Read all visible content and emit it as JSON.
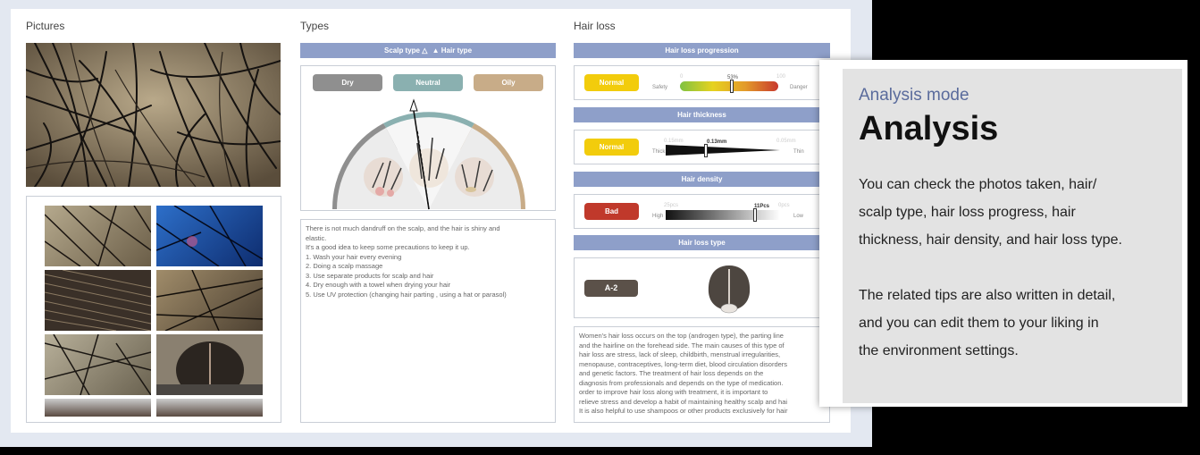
{
  "sections": {
    "pictures": "Pictures",
    "types": "Types",
    "hair_loss": "Hair loss"
  },
  "types": {
    "banner_scalp": "Scalp type",
    "banner_hair": "Hair type",
    "buttons": [
      "Dry",
      "Neutral",
      "Oily"
    ],
    "tips_lines": [
      "There is not much dandruff on the scalp, and the hair is shiny and",
      "elastic.",
      "It's a good idea to keep some precautions to keep it up.",
      "1. Wash your hair every evening",
      "2. Doing a scalp massage",
      "3. Use separate products for scalp and hair",
      "4. Dry enough with a towel when drying your hair",
      "5. Use UV protection (changing hair parting , using a hat or parasol)"
    ]
  },
  "hair_loss": {
    "progression": {
      "title": "Hair loss progression",
      "status": "Normal",
      "status_color": "#f2cc0c",
      "left": "Safety",
      "right": "Danger",
      "min": "0",
      "max": "100",
      "value_label": "53%",
      "value": 0.53
    },
    "thickness": {
      "title": "Hair thickness",
      "status": "Normal",
      "status_color": "#f2cc0c",
      "left": "Thick",
      "right": "Thin",
      "min": "0.15mm",
      "max": "0.05mm",
      "value_label": "0.13mm",
      "value": 0.35
    },
    "density": {
      "title": "Hair density",
      "status": "Bad",
      "status_color": "#c0392b",
      "left": "High",
      "right": "Low",
      "min": "25pcs",
      "max": "0pcs",
      "value_label": "11Pcs",
      "value": 0.78
    },
    "type": {
      "title": "Hair loss type",
      "badge": "A-2"
    },
    "desc_lines": [
      "Women's hair loss occurs on the top (androgen type), the parting line",
      "and the hairline on the forehead side. The main causes of this type of",
      "hair loss are stress, lack of sleep, childbirth, menstrual irregularities,",
      "menopause, contraceptives, long-term diet, blood circulation disorders",
      "and genetic factors. The treatment of hair loss depends on the",
      "diagnosis from professionals and depends on the type of medication.",
      "order to improve hair loss along with treatment, it is important to",
      "relieve stress and develop a habit of maintaining healthy scalp and hai",
      "It is also helpful to use shampoos or other products exclusively for hair"
    ]
  },
  "panel": {
    "label": "Analysis mode",
    "heading": "Analysis",
    "body_lines": [
      "You can check the photos taken, hair/",
      "scalp type, hair loss progress, hair",
      "thickness, hair density, and hair loss type.",
      "",
      "The related tips are also written in detail,",
      "and you can edit them to your liking in",
      "the environment settings."
    ]
  },
  "colors": {
    "banner": "#8e9fc9",
    "dry": "#8f8f8f",
    "neutral": "#8ab0b0",
    "oily": "#c8ac88",
    "badge": "#5b5149"
  }
}
